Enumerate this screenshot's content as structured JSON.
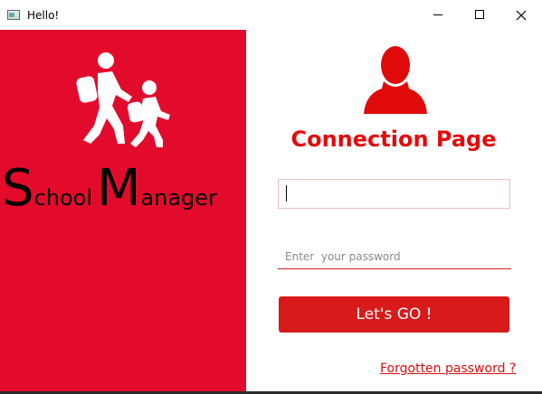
{
  "window": {
    "title": "Hello!",
    "app_icon": "window-app-icon",
    "controls": [
      "minimize-icon",
      "maximize-icon",
      "close-icon"
    ]
  },
  "brand": {
    "icon": "school-walkers-icon",
    "school_initial": "S",
    "school_rest": "chool",
    "manager_initial": "M",
    "manager_rest": "anager",
    "panel_color": "#e30b2c"
  },
  "login": {
    "avatar_icon": "user-silhouette-icon",
    "heading": "Connection Page",
    "username_value": "",
    "password_placeholder": "Enter  your password",
    "submit_label": "Let's GO !",
    "forgot_link": "Forgotten password ?",
    "accent_color": "#e30b0b"
  }
}
